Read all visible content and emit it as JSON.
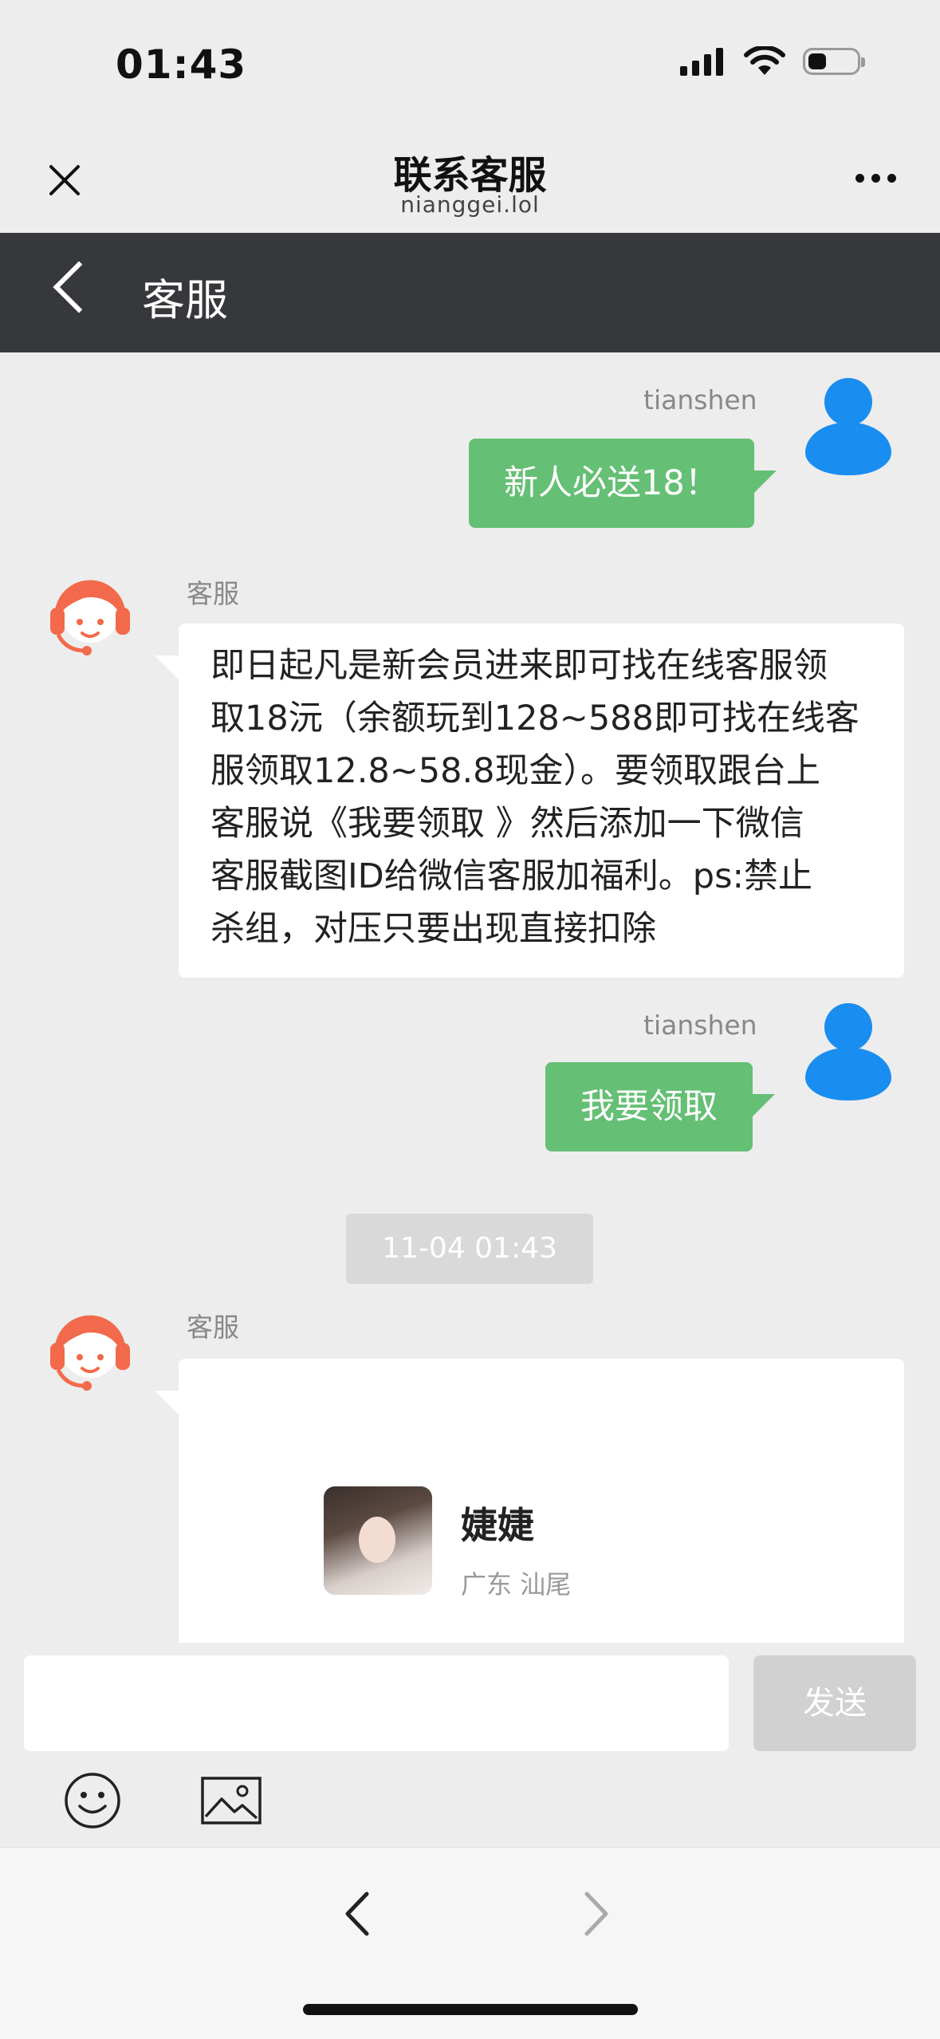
{
  "status_bar": {
    "time": "01:43"
  },
  "header": {
    "title": "联系客服",
    "domain": "nianggei.lol"
  },
  "chat_header": {
    "title": "客服"
  },
  "messages": [
    {
      "sender": "tianshen",
      "side": "right",
      "text": "新人必送18！"
    },
    {
      "sender": "客服",
      "side": "left",
      "lines": [
        "即日起凡是新会员进来即可找在线客服领",
        "取18沅（余额玩到128~588即可找在线客",
        "服领取12.8~58.8现金）。要领取跟台上",
        "客服说《我要领取 》然后添加一下微信",
        "客服截图ID给微信客服加福利。ps:禁止",
        "杀组，对压只要出现直接扣除"
      ]
    },
    {
      "sender": "tianshen",
      "side": "right",
      "text": "我要领取"
    }
  ],
  "timestamp": "11-04 01:43",
  "card_message": {
    "sender": "客服",
    "name": "婕婕",
    "location": "广东 汕尾"
  },
  "input": {
    "placeholder": "",
    "value": "",
    "send_label": "发送"
  },
  "colors": {
    "bubble_green": "#65bf74",
    "header_dark": "#37383b",
    "user_avatar": "#1a8df0",
    "agent_avatar": "#f26a4b"
  }
}
